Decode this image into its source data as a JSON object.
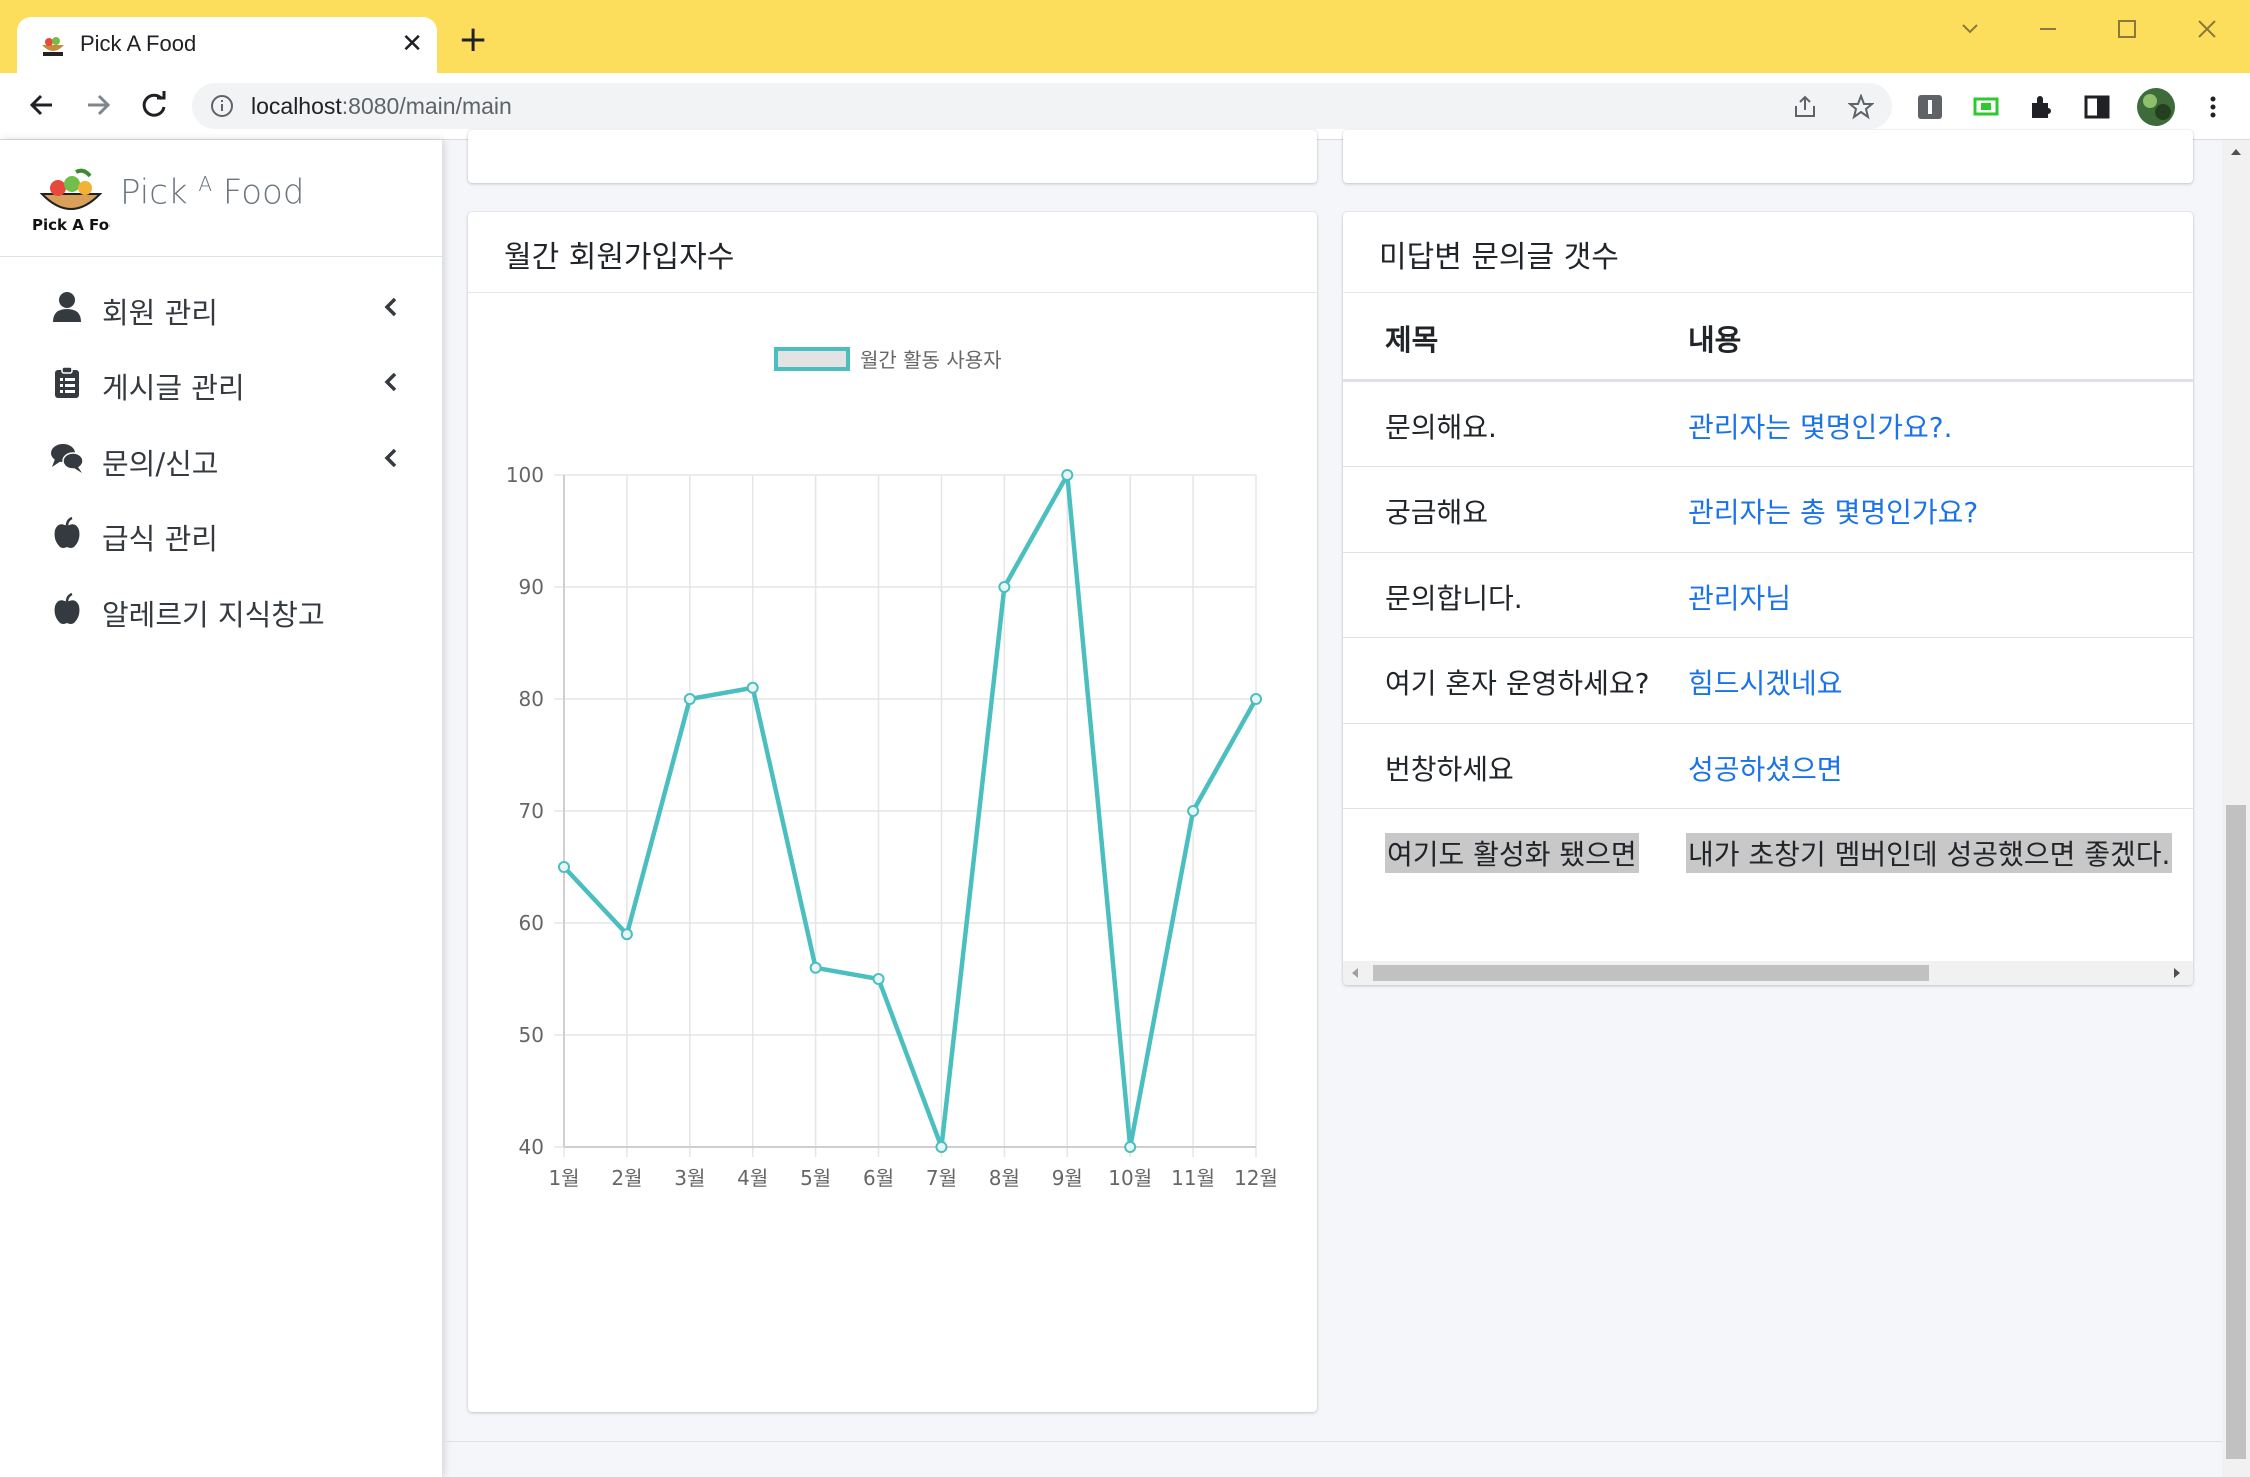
{
  "browser": {
    "tab_title": "Pick A Food",
    "new_tab_symbol": "+",
    "close_tab_symbol": "✕",
    "url_host": "localhost",
    "url_path": ":8080/main/main"
  },
  "brand": {
    "name_left": "Pick",
    "name_sup": "A",
    "name_right": "Food",
    "logo_caption": "Pick A Food"
  },
  "sidebar": {
    "items": [
      {
        "label": "회원 관리",
        "icon": "user-icon",
        "has_children": true
      },
      {
        "label": "게시글 관리",
        "icon": "clipboard-icon",
        "has_children": true
      },
      {
        "label": "문의/신고",
        "icon": "comments-icon",
        "has_children": true
      },
      {
        "label": "급식 관리",
        "icon": "apple-icon",
        "has_children": false
      },
      {
        "label": "알레르기 지식창고",
        "icon": "apple-icon",
        "has_children": false
      }
    ]
  },
  "signup_card": {
    "title": "월간 회원가입자수"
  },
  "inquiry_card": {
    "title": "미답변 문의글 갯수",
    "columns": [
      "제목",
      "내용"
    ],
    "rows": [
      {
        "title": "문의해요.",
        "content": "관리자는 몇명인가요?."
      },
      {
        "title": "궁금해요",
        "content": "관리자는 총 몇명인가요?"
      },
      {
        "title": "문의합니다.",
        "content": "관리자님"
      },
      {
        "title": "여기 혼자 운영하세요?",
        "content": "힘드시겠네요"
      },
      {
        "title": "번창하세요",
        "content": "성공하셨으면"
      },
      {
        "title": "여기도 활성화 됐으면",
        "content": "내가 초창기 멤버인데 성공했으면 좋겠다.",
        "selected": true
      }
    ]
  },
  "colors": {
    "accent_line": "#4bbfbf",
    "link": "#1a73e8",
    "chrome_yellow": "#fdde5c"
  },
  "chart_data": {
    "type": "line",
    "title": "",
    "xlabel": "",
    "ylabel": "",
    "categories": [
      "1월",
      "2월",
      "3월",
      "4월",
      "5월",
      "6월",
      "7월",
      "8월",
      "9월",
      "10월",
      "11월",
      "12월"
    ],
    "series": [
      {
        "name": "월간 활동 사용자",
        "values": [
          65,
          59,
          80,
          81,
          56,
          55,
          40,
          90,
          100,
          40,
          70,
          80
        ]
      }
    ],
    "ylim": [
      40,
      100
    ],
    "yticks": [
      40,
      50,
      60,
      70,
      80,
      90,
      100
    ],
    "grid": true,
    "legend": "top"
  }
}
